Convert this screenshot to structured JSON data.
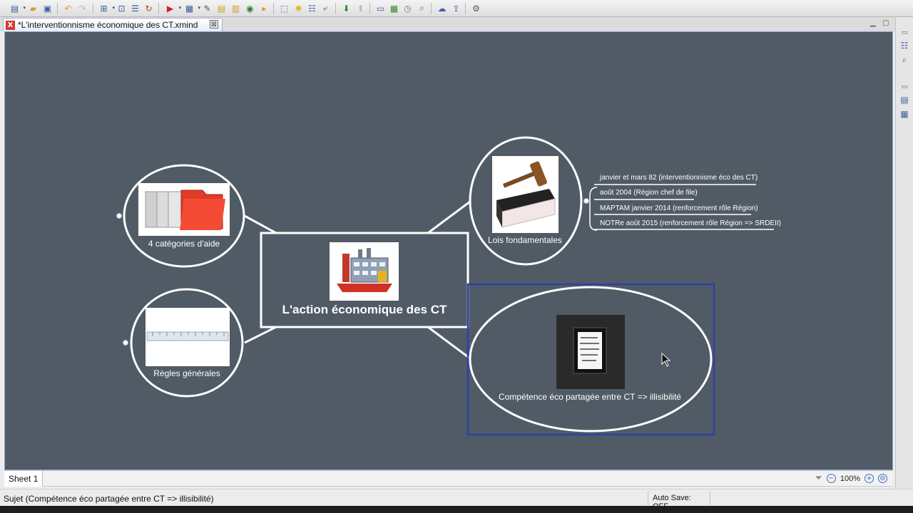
{
  "editor": {
    "tab_title": "*L'interventionnisme  économique des CT.xmind",
    "tab_close": "⊠"
  },
  "map": {
    "central_topic": "L'action économique des CT",
    "topics": {
      "aide": "4 catégories d'aide",
      "regles": "Règles générales",
      "lois": "Lois fondamentales",
      "competence": "Compétence éco partagée entre CT => illisibilité"
    },
    "lois_subtopics": [
      "janvier et mars 82 (interventionnisme éco des CT)",
      "août 2004 (Région chef de file)",
      "MAPTAM janvier 2014 (renforcement rôle Région)",
      "NOTRe août 2015 (renforcement rôle Région => SRDEII)"
    ]
  },
  "sheet_tab": "Sheet 1",
  "zoom": {
    "level": "100%",
    "zoom_out": "−",
    "zoom_in": "+",
    "fit": "⊜"
  },
  "status": {
    "selection": "Sujet (Compétence éco partagée entre CT => illisibilité)",
    "autosave": "Auto Save: OFF"
  },
  "colors": {
    "canvas_bg": "#515b65",
    "selection_border": "#2f3fa8",
    "topic_border": "#ffffff"
  }
}
